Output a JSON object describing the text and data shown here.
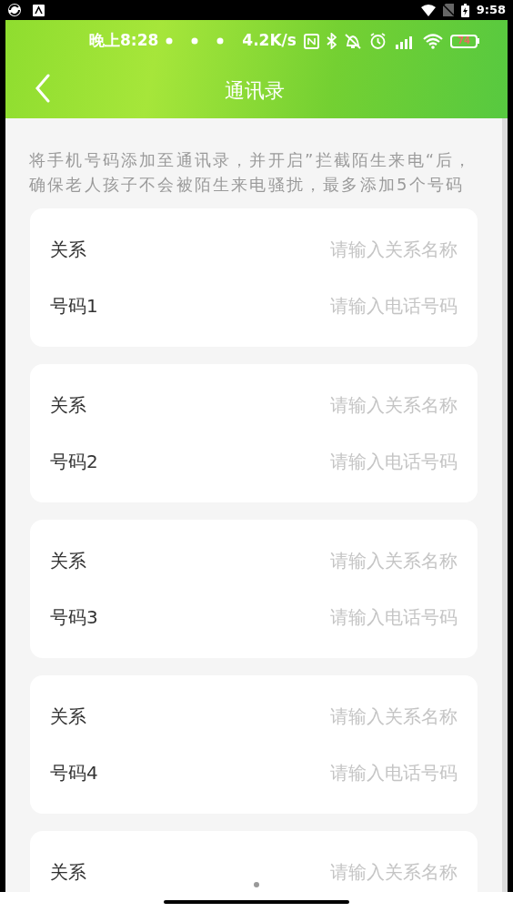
{
  "system_status": {
    "time": "9:58"
  },
  "app_status": {
    "time": "晚上8:28",
    "speed": "4.2K/s",
    "battery": "74"
  },
  "header": {
    "title": "通讯录"
  },
  "description": "将手机号码添加至通讯录，并开启”拦截陌生来电“后，确保老人孩子不会被陌生来电骚扰，最多添加5个号码",
  "cards": [
    {
      "rows": [
        {
          "label": "关系",
          "placeholder": "请输入关系名称"
        },
        {
          "label": "号码1",
          "placeholder": "请输入电话号码"
        }
      ]
    },
    {
      "rows": [
        {
          "label": "关系",
          "placeholder": "请输入关系名称"
        },
        {
          "label": "号码2",
          "placeholder": "请输入电话号码"
        }
      ]
    },
    {
      "rows": [
        {
          "label": "关系",
          "placeholder": "请输入关系名称"
        },
        {
          "label": "号码3",
          "placeholder": "请输入电话号码"
        }
      ]
    },
    {
      "rows": [
        {
          "label": "关系",
          "placeholder": "请输入关系名称"
        },
        {
          "label": "号码4",
          "placeholder": "请输入电话号码"
        }
      ]
    },
    {
      "rows": [
        {
          "label": "关系",
          "placeholder": "请输入关系名称"
        }
      ]
    }
  ]
}
